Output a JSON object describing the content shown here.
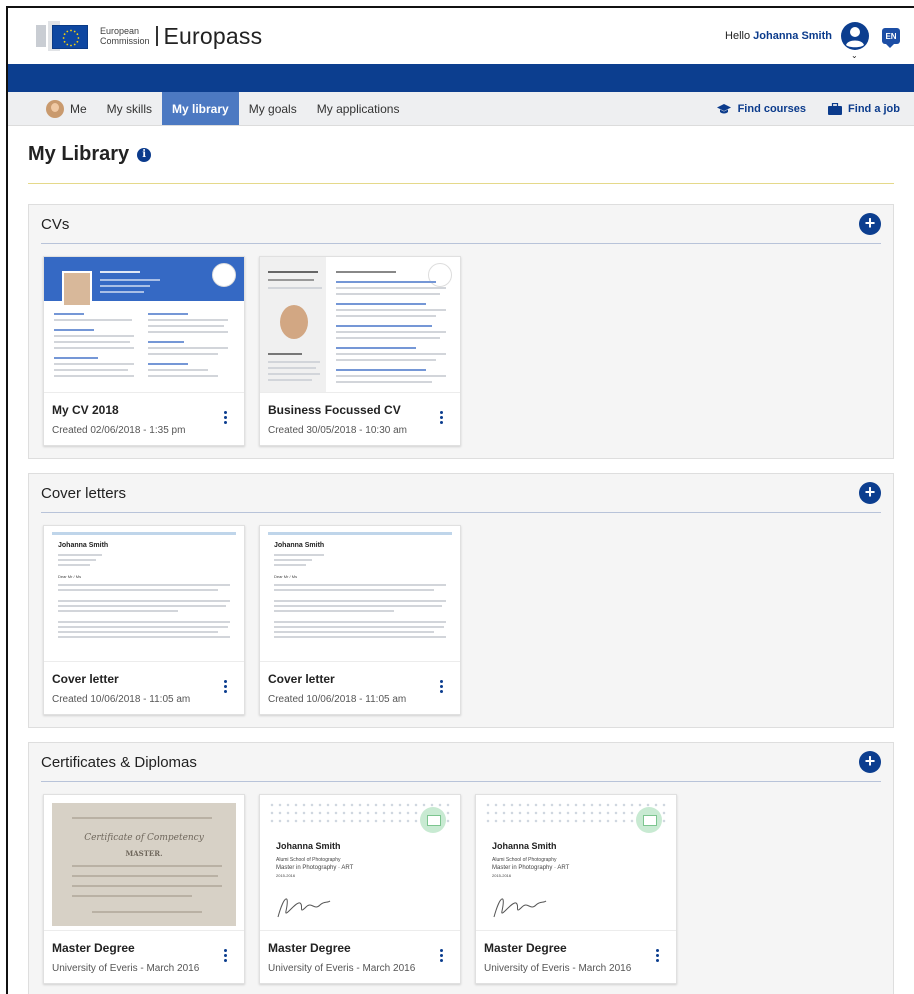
{
  "header": {
    "ec_line1": "European",
    "ec_line2": "Commission",
    "app_name": "Europass",
    "hello_prefix": "Hello",
    "user_name": "Johanna Smith",
    "lang": "EN"
  },
  "nav": {
    "items": [
      {
        "label": "Me"
      },
      {
        "label": "My skills"
      },
      {
        "label": "My library",
        "active": true
      },
      {
        "label": "My goals"
      },
      {
        "label": "My applications"
      }
    ],
    "find_courses": "Find courses",
    "find_job": "Find a job"
  },
  "page": {
    "title": "My Library"
  },
  "sections": {
    "cvs": {
      "title": "CVs",
      "add": "+",
      "cards": [
        {
          "title": "My CV 2018",
          "sub": "Created 02/06/2018 - 1:35 pm"
        },
        {
          "title": "Business Focussed CV",
          "sub": "Created 30/05/2018 - 10:30 am"
        }
      ]
    },
    "letters": {
      "title": "Cover letters",
      "add": "+",
      "cards": [
        {
          "title": "Cover letter",
          "sub": "Created 10/06/2018 - 11:05 am"
        },
        {
          "title": "Cover letter",
          "sub": "Created 10/06/2018 - 11:05 am"
        }
      ],
      "thumb": {
        "name": "Johanna Smith",
        "p1": "Dear Mr / Ms"
      }
    },
    "certs": {
      "title": "Certificates & Diplomas",
      "add": "+",
      "cards": [
        {
          "title": "Master Degree",
          "sub": "University of Everis - March 2016"
        },
        {
          "title": "Master Degree",
          "sub": "University of Everis - March 2016"
        },
        {
          "title": "Master Degree",
          "sub": "University of Everis - March 2016"
        }
      ],
      "thumb": {
        "name": "Johanna Smith",
        "school": "Alumi School of Photography",
        "degree": "Master in Photography · ART",
        "years": "2015-2016",
        "parch_title": "Certificate of Competency",
        "parch_sub": "MASTER."
      }
    }
  },
  "colors": {
    "brand_blue": "#0c3e8f",
    "nav_active": "#4c79c2",
    "title_rule": "#e5d98a"
  }
}
